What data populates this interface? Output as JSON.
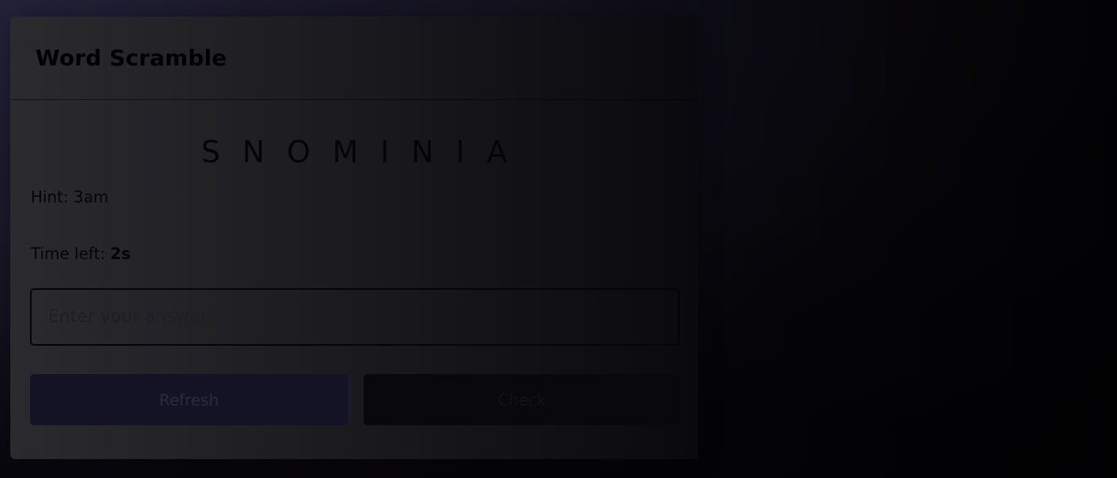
{
  "app": {
    "title": "Word Scramble"
  },
  "game": {
    "scrambled_word": "SNOMINIA",
    "hint_label": "Hint: ",
    "hint_value": "3am",
    "time_label": "Time left: ",
    "time_value": "2s"
  },
  "answer": {
    "placeholder": "Enter your answer!",
    "value": ""
  },
  "buttons": {
    "refresh_label": "Refresh",
    "check_label": "Check"
  },
  "colors": {
    "refresh_bg": "#141326",
    "check_bg": "#09090b"
  }
}
